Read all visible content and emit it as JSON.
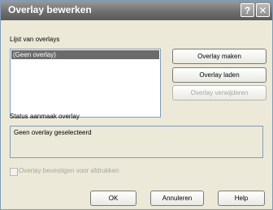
{
  "window": {
    "title": "Overlay bewerken",
    "help_glyph": "?",
    "close_glyph": "✕"
  },
  "overlay_list": {
    "label": "Lijst van overlays",
    "items": [
      "(Geen overlay)"
    ],
    "selected_index": 0
  },
  "actions": {
    "create": "Overlay maken",
    "load": "Overlay laden",
    "delete": "Overlay verwijderen",
    "delete_enabled": false
  },
  "status": {
    "label": "Status aanmaak overlay",
    "text": "Geen overlay geselecteerd"
  },
  "confirm_print": {
    "label": "Overlay bevestigen voor afdrukken",
    "checked": false,
    "enabled": false
  },
  "footer": {
    "ok": "OK",
    "cancel": "Annuleren",
    "help": "Help"
  }
}
